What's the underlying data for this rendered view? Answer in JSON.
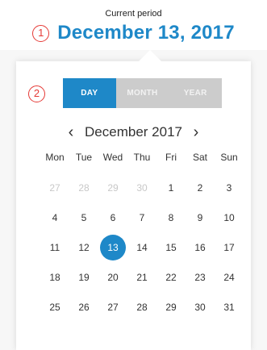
{
  "header": {
    "caption": "Current period",
    "marker": "1",
    "title": "December 13, 2017"
  },
  "panel": {
    "marker": "2"
  },
  "view_toggle": {
    "options": [
      "DAY",
      "MONTH",
      "YEAR"
    ],
    "active": "DAY"
  },
  "month_nav": {
    "prev_icon": "chevron-left-icon",
    "prev_glyph": "‹",
    "label": "December 2017",
    "next_icon": "chevron-right-icon",
    "next_glyph": "›"
  },
  "weekdays": [
    "Mon",
    "Tue",
    "Wed",
    "Thu",
    "Fri",
    "Sat",
    "Sun"
  ],
  "weeks": [
    [
      {
        "d": "27",
        "muted": true
      },
      {
        "d": "28",
        "muted": true
      },
      {
        "d": "29",
        "muted": true
      },
      {
        "d": "30",
        "muted": true
      },
      {
        "d": "1"
      },
      {
        "d": "2"
      },
      {
        "d": "3"
      }
    ],
    [
      {
        "d": "4"
      },
      {
        "d": "5"
      },
      {
        "d": "6"
      },
      {
        "d": "7"
      },
      {
        "d": "8"
      },
      {
        "d": "9"
      },
      {
        "d": "10"
      }
    ],
    [
      {
        "d": "11"
      },
      {
        "d": "12"
      },
      {
        "d": "13",
        "selected": true
      },
      {
        "d": "14"
      },
      {
        "d": "15"
      },
      {
        "d": "16"
      },
      {
        "d": "17"
      }
    ],
    [
      {
        "d": "18"
      },
      {
        "d": "19"
      },
      {
        "d": "20"
      },
      {
        "d": "21"
      },
      {
        "d": "22"
      },
      {
        "d": "23"
      },
      {
        "d": "24"
      }
    ],
    [
      {
        "d": "25"
      },
      {
        "d": "26"
      },
      {
        "d": "27"
      },
      {
        "d": "28"
      },
      {
        "d": "29"
      },
      {
        "d": "30"
      },
      {
        "d": "31"
      }
    ]
  ],
  "colors": {
    "accent": "#1e88c8",
    "marker": "#e53935",
    "muted_day": "#c8c8c8",
    "toggle_inactive": "#cccccc"
  }
}
